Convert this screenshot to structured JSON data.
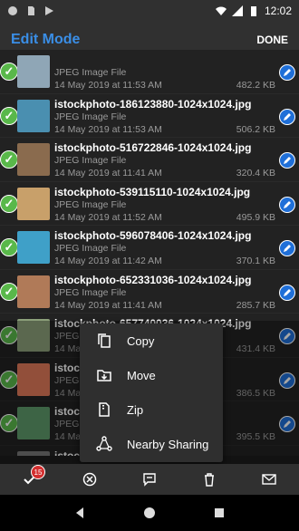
{
  "status_bar": {
    "time": "12:02"
  },
  "app_bar": {
    "title": "Edit Mode",
    "done_label": "DONE"
  },
  "files": [
    {
      "name": "",
      "type": "JPEG Image File",
      "date": "14 May 2019 at 11:53 AM",
      "size": "482.2 KB",
      "thumb": "#8fa6b6"
    },
    {
      "name": "istockphoto-186123880-1024x1024.jpg",
      "type": "JPEG Image File",
      "date": "14 May 2019 at 11:53 AM",
      "size": "506.2 KB",
      "thumb": "#4a8fb0"
    },
    {
      "name": "istockphoto-516722846-1024x1024.jpg",
      "type": "JPEG Image File",
      "date": "14 May 2019 at 11:41 AM",
      "size": "320.4 KB",
      "thumb": "#8a6b4e"
    },
    {
      "name": "istockphoto-539115110-1024x1024.jpg",
      "type": "JPEG Image File",
      "date": "14 May 2019 at 11:52 AM",
      "size": "495.9 KB",
      "thumb": "#c8a06a"
    },
    {
      "name": "istockphoto-596078406-1024x1024.jpg",
      "type": "JPEG Image File",
      "date": "14 May 2019 at 11:42 AM",
      "size": "370.1 KB",
      "thumb": "#3fa0c8"
    },
    {
      "name": "istockphoto-652331036-1024x1024.jpg",
      "type": "JPEG Image File",
      "date": "14 May 2019 at 11:41 AM",
      "size": "285.7 KB",
      "thumb": "#b07a58"
    },
    {
      "name": "istockphoto-657740036-1024x1024.jpg",
      "type": "JPEG Image File",
      "date": "14 May 2019 at 11:41 AM",
      "size": "431.4 KB",
      "thumb": "#8ca07a"
    },
    {
      "name": "istockphoto-",
      "type": "JPEG Image File",
      "date": "14 May 2019 at 11:41 AM",
      "size": "386.5 KB",
      "thumb": "#e07a5a"
    },
    {
      "name": "istockphoto-",
      "type": "JPEG Image File",
      "date": "14 May 2019 at 11:41 AM",
      "size": "395.5 KB",
      "thumb": "#5f9a6a"
    },
    {
      "name": "istockphoto-",
      "type": "",
      "date": "",
      "size": "",
      "thumb": "#777777"
    }
  ],
  "context_menu": [
    {
      "label": "Copy",
      "icon": "copy-icon"
    },
    {
      "label": "Move",
      "icon": "move-icon"
    },
    {
      "label": "Zip",
      "icon": "zip-icon"
    },
    {
      "label": "Nearby Sharing",
      "icon": "nearby-share-icon"
    }
  ],
  "bottom_bar": {
    "selected_count": "15"
  },
  "colors": {
    "accent": "#3a8ee6",
    "check": "#59b84a",
    "edit": "#1f6fd8",
    "badge": "#d32f2f"
  }
}
